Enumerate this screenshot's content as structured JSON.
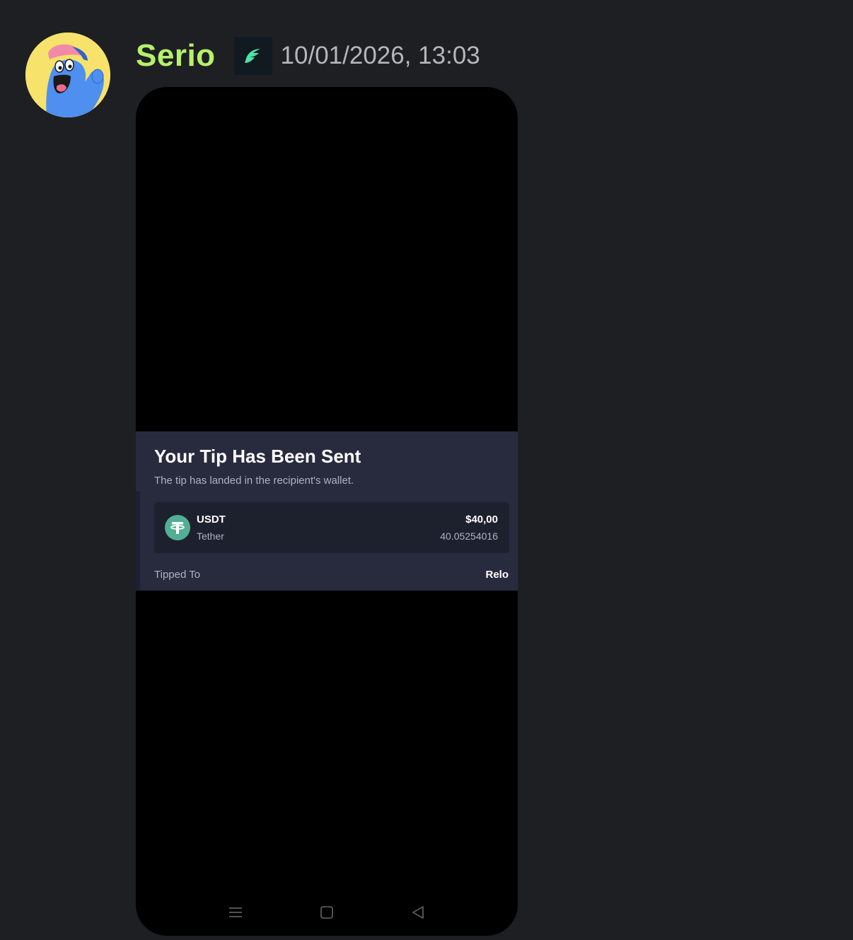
{
  "message": {
    "username": "Serio",
    "username_color": "#b5f16a",
    "timestamp": "10/01/2026, 13:03",
    "avatar_icon": "blue-cartoon-avatar-icon",
    "badge_icon": "green-leaf-badge-icon"
  },
  "attachment": {
    "tip_card": {
      "title": "Your Tip Has Been Sent",
      "subtitle": "The tip has landed in the recipient's wallet.",
      "coin": {
        "icon": "tether-icon",
        "symbol": "USDT",
        "name": "Tether",
        "usd_value": "$40,00",
        "amount": "40.05254016"
      },
      "tipped_to_label": "Tipped To",
      "tipped_to_value": "Relo"
    },
    "navbar": {
      "menu_icon": "menu-icon",
      "home_icon": "home-square-icon",
      "back_icon": "back-triangle-icon"
    }
  },
  "colors": {
    "background": "#1e1f23",
    "panel": "#282b3d",
    "tether": "#50af95"
  }
}
